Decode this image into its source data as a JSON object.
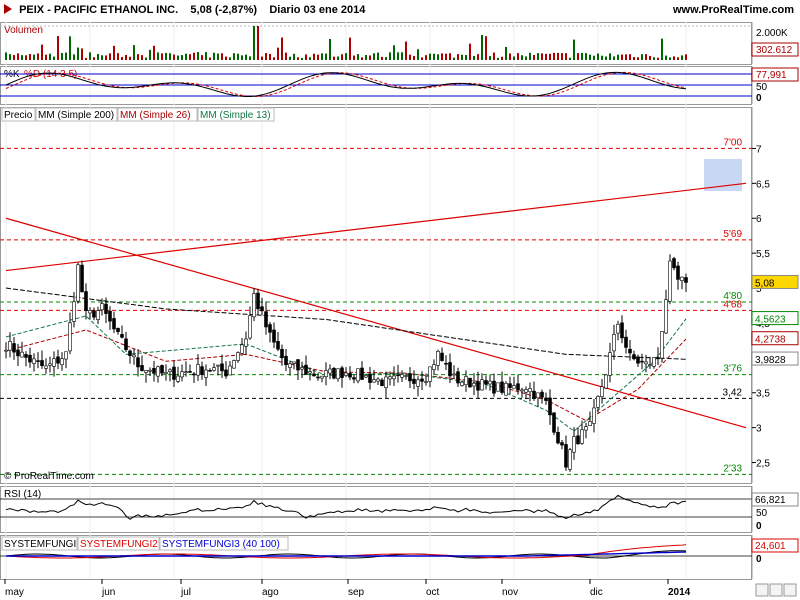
{
  "header": {
    "ticker": "PEIX",
    "company": "PACIFIC ETHANOL INC.",
    "quote": "5,08 (-2,87%)",
    "period": "Diario",
    "date": "03 ene 2014",
    "site": "www.ProRealTime.com"
  },
  "colors": {
    "up": "#006600",
    "down": "#aa0000",
    "red": "#dd0000",
    "green": "#008800",
    "blue": "#0000cc",
    "shade": "#c8d8f4"
  },
  "panels": {
    "volume": {
      "label": "Volumen",
      "axis": [
        "2.000K",
        "302.612"
      ]
    },
    "stoch": {
      "label_k": "%K",
      "label_d": "%D (14 3 5)",
      "axis": [
        "77,991",
        "50",
        "0"
      ]
    },
    "price": {
      "labels": [
        "Precio",
        "MM (Simple 200)",
        "MM (Simple 26)",
        "MM (Simple 13)"
      ],
      "axis": [
        "7",
        "6,5",
        "6",
        "5,5",
        "5",
        "4,5",
        "4",
        "3,5",
        "3",
        "2,5"
      ],
      "levels": [
        {
          "text": "7'00",
          "value": 7.0,
          "color": "#dd0000"
        },
        {
          "text": "5'69",
          "value": 5.69,
          "color": "#dd0000"
        },
        {
          "text": "4'80",
          "value": 4.8,
          "color": "#008800"
        },
        {
          "text": "4'68",
          "value": 4.68,
          "color": "#dd0000"
        },
        {
          "text": "3'76",
          "value": 3.76,
          "color": "#008800"
        },
        {
          "text": "3,42",
          "value": 3.42,
          "color": "#000000"
        },
        {
          "text": "2'33",
          "value": 2.33,
          "color": "#008800"
        }
      ],
      "markers": [
        {
          "text": "5,08",
          "value": 5.08,
          "bg": "#ffd700",
          "color": "#000000"
        },
        {
          "text": "4,5623",
          "value": 4.5623,
          "bg": "#ffffff",
          "color": "#008800"
        },
        {
          "text": "4,2738",
          "value": 4.2738,
          "bg": "#ffffff",
          "color": "#aa0000"
        },
        {
          "text": "3,9828",
          "value": 3.9828,
          "bg": "#ffffff",
          "color": "#000000"
        }
      ],
      "copyright": "© ProRealTime.com"
    },
    "rsi": {
      "label": "RSI (14)",
      "axis": [
        "66,821",
        "50",
        "0"
      ]
    },
    "systemfungi": {
      "labels": [
        "SYSTEMFUNGI",
        "SYSTEMFUNGI2",
        "SYSTEMFUNGI3 (40 100)"
      ],
      "axis": [
        "24,601",
        "0"
      ]
    }
  },
  "xaxis": [
    "may",
    "jun",
    "jul",
    "ago",
    "sep",
    "oct",
    "nov",
    "dic",
    "2014"
  ],
  "chart_data": {
    "type": "candlestick",
    "ylim": [
      2.25,
      7.35
    ],
    "months": [
      "may",
      "jun",
      "jul",
      "ago",
      "sep",
      "oct",
      "nov",
      "dic",
      "2014"
    ],
    "close_anchors": [
      [
        0,
        4.2
      ],
      [
        5,
        4.0
      ],
      [
        10,
        3.85
      ],
      [
        15,
        4.05
      ],
      [
        18,
        5.3
      ],
      [
        20,
        4.6
      ],
      [
        24,
        4.7
      ],
      [
        28,
        4.3
      ],
      [
        33,
        3.9
      ],
      [
        40,
        3.75
      ],
      [
        45,
        3.8
      ],
      [
        50,
        3.85
      ],
      [
        55,
        3.8
      ],
      [
        60,
        4.3
      ],
      [
        62,
        4.9
      ],
      [
        66,
        4.3
      ],
      [
        70,
        3.9
      ],
      [
        78,
        3.75
      ],
      [
        85,
        3.8
      ],
      [
        95,
        3.65
      ],
      [
        105,
        3.75
      ],
      [
        108,
        4.05
      ],
      [
        112,
        3.7
      ],
      [
        120,
        3.6
      ],
      [
        125,
        3.55
      ],
      [
        130,
        3.6
      ],
      [
        135,
        3.35
      ],
      [
        138,
        2.85
      ],
      [
        140,
        2.5
      ],
      [
        142,
        2.8
      ],
      [
        146,
        3.0
      ],
      [
        150,
        3.8
      ],
      [
        153,
        4.5
      ],
      [
        156,
        4.0
      ],
      [
        160,
        3.9
      ],
      [
        163,
        4.0
      ],
      [
        166,
        5.3
      ],
      [
        168,
        5.1
      ],
      [
        170,
        5.08
      ]
    ],
    "series": [
      {
        "name": "MM (Simple 200)",
        "values": [
          [
            0,
            5.0
          ],
          [
            40,
            4.7
          ],
          [
            80,
            4.55
          ],
          [
            110,
            4.3
          ],
          [
            140,
            4.05
          ],
          [
            170,
            3.98
          ]
        ]
      },
      {
        "name": "MM (Simple 26)",
        "values": [
          [
            0,
            4.1
          ],
          [
            20,
            4.4
          ],
          [
            40,
            3.95
          ],
          [
            60,
            4.05
          ],
          [
            80,
            3.8
          ],
          [
            100,
            3.78
          ],
          [
            120,
            3.65
          ],
          [
            135,
            3.4
          ],
          [
            145,
            3.1
          ],
          [
            158,
            3.55
          ],
          [
            170,
            4.27
          ]
        ]
      },
      {
        "name": "MM (Simple 13)",
        "values": [
          [
            0,
            4.3
          ],
          [
            20,
            4.6
          ],
          [
            30,
            4.05
          ],
          [
            60,
            4.2
          ],
          [
            80,
            3.75
          ],
          [
            100,
            3.78
          ],
          [
            120,
            3.62
          ],
          [
            135,
            3.25
          ],
          [
            142,
            2.95
          ],
          [
            150,
            3.35
          ],
          [
            162,
            3.95
          ],
          [
            170,
            4.56
          ]
        ]
      }
    ],
    "trendlines": [
      {
        "from": [
          0,
          6.0
        ],
        "to": [
          185,
          3.0
        ]
      },
      {
        "from": [
          0,
          5.25
        ],
        "to": [
          185,
          6.5
        ]
      }
    ]
  }
}
